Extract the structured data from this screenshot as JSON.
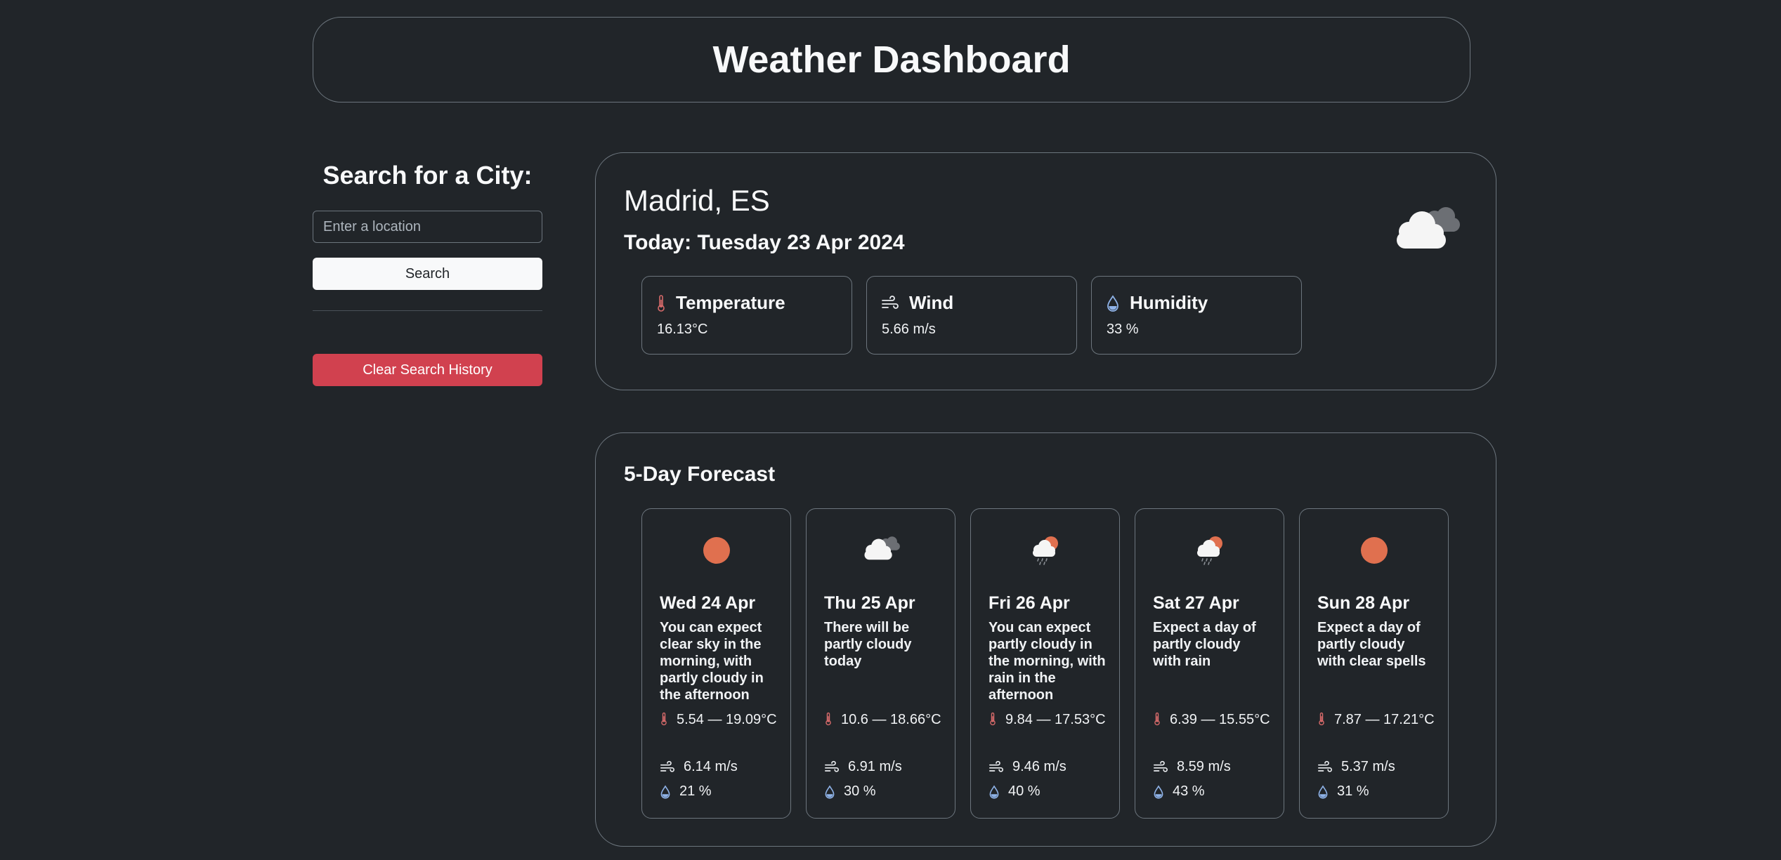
{
  "header": {
    "title": "Weather Dashboard"
  },
  "sidebar": {
    "heading": "Search for a City:",
    "search_placeholder": "Enter a location",
    "search_value": "",
    "search_button": "Search",
    "clear_button": "Clear Search History"
  },
  "current": {
    "city": "Madrid, ES",
    "date": "Today: Tuesday 23 Apr 2024",
    "icon": "cloudy-icon",
    "temperature": {
      "label": "Temperature",
      "value": "16.13°C"
    },
    "wind": {
      "label": "Wind",
      "value": "5.66 m/s"
    },
    "humidity": {
      "label": "Humidity",
      "value": "33 %"
    }
  },
  "forecast": {
    "title": "5-Day Forecast",
    "days": [
      {
        "date": "Wed 24 Apr",
        "icon": "sun-icon",
        "desc": "You can expect clear sky in the morning, with partly cloudy in the afternoon",
        "temp": "5.54 — 19.09°C",
        "wind": "6.14 m/s",
        "humidity": "21 %"
      },
      {
        "date": "Thu 25 Apr",
        "icon": "cloudy-icon",
        "desc": "There will be partly cloudy today",
        "temp": "10.6 — 18.66°C",
        "wind": "6.91 m/s",
        "humidity": "30 %"
      },
      {
        "date": "Fri 26 Apr",
        "icon": "sun-rain-icon",
        "desc": "You can expect partly cloudy in the morning, with rain in the afternoon",
        "temp": "9.84 — 17.53°C",
        "wind": "9.46 m/s",
        "humidity": "40 %"
      },
      {
        "date": "Sat 27 Apr",
        "icon": "sun-rain-icon",
        "desc": "Expect a day of partly cloudy with rain",
        "temp": "6.39 — 15.55°C",
        "wind": "8.59 m/s",
        "humidity": "43 %"
      },
      {
        "date": "Sun 28 Apr",
        "icon": "sun-icon",
        "desc": "Expect a day of partly cloudy with clear spells",
        "temp": "7.87 — 17.21°C",
        "wind": "5.37 m/s",
        "humidity": "31 %"
      }
    ]
  },
  "colors": {
    "background": "#212529",
    "border": "#6c757d",
    "danger": "#d1414f",
    "sun": "#e0704f"
  }
}
